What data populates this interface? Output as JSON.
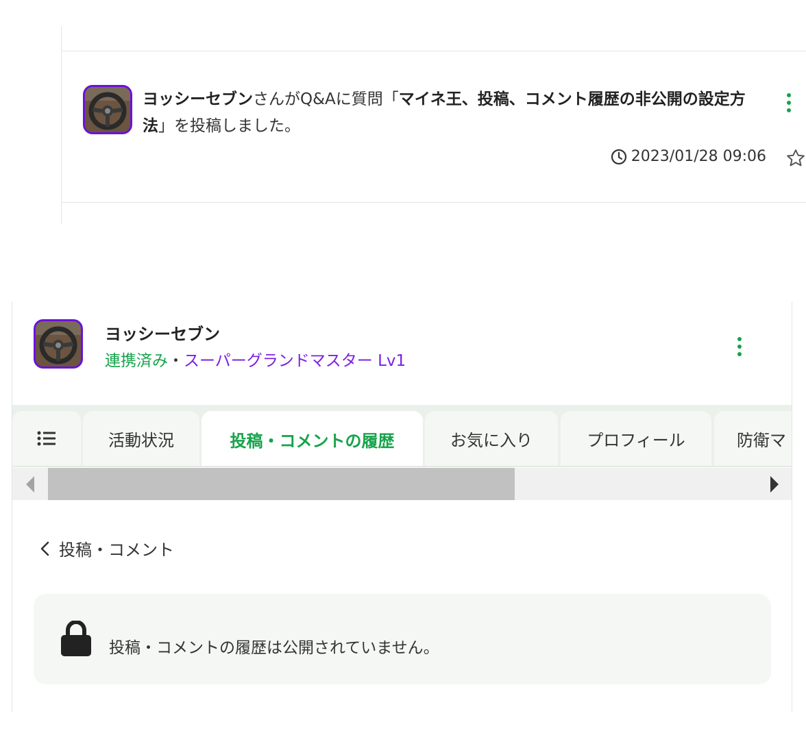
{
  "activity": {
    "user_name": "ヨッシーセブン",
    "text_mid": "さんがQ&Aに質問「",
    "question_title": "マイネ王、投稿、コメント履歴の非公開の設定方法",
    "text_end": "」を投稿しました。",
    "timestamp": "2023/01/28 09:06",
    "icons": {
      "clock": "clock-icon",
      "star": "star-icon",
      "menu": "more-vertical-icon"
    }
  },
  "profile": {
    "name": "ヨッシーセブン",
    "linked": "連携済み",
    "separator": "・",
    "rank": "スーパーグランドマスター Lv1",
    "icons": {
      "menu": "more-vertical-icon"
    }
  },
  "tabs": [
    {
      "label": "",
      "icon": "list-icon"
    },
    {
      "label": "活動状況"
    },
    {
      "label": "投稿・コメントの履歴",
      "active": true
    },
    {
      "label": "お気に入り"
    },
    {
      "label": "プロフィール"
    },
    {
      "label": "防衛マ"
    }
  ],
  "scrollbar": {
    "thumb_fraction": 0.6
  },
  "back_link": {
    "label": "投稿・コメント"
  },
  "notice": {
    "message": "投稿・コメントの履歴は公開されていません。"
  },
  "colors": {
    "accent_green": "#16a34a",
    "rank_purple": "#7c1fe0",
    "avatar_border": "#6b12d8"
  }
}
